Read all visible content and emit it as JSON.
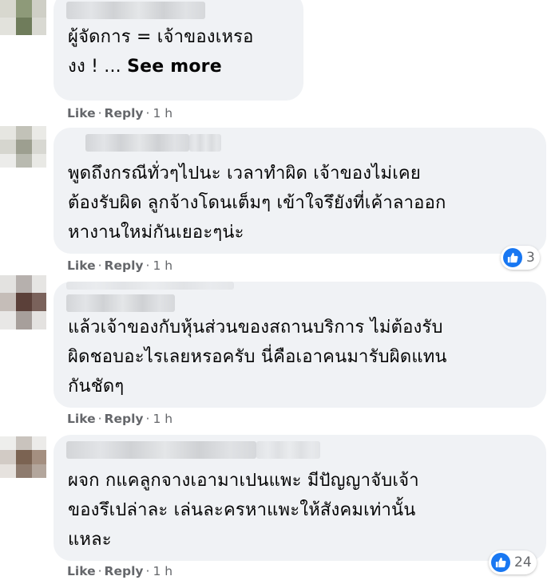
{
  "comments": [
    {
      "lines": [
        "ผู้จัดการ = เจ้าของเหรอ",
        "งง ! ... "
      ],
      "see_more": "See more",
      "actions": {
        "like": "Like",
        "reply": "Reply",
        "sep": "·",
        "time": "1 h"
      },
      "reactions": null
    },
    {
      "lines": [
        "พูดถึงกรณีทั่วๆไปนะ เวลาทำผิด เจ้าของไม่เคย",
        "ต้องรับผิด ลูกจ้างโดนเต็มๆ เข้าใจรึยังที่เค้าลาออก",
        "หางานใหม่กันเยอะๆน่ะ"
      ],
      "actions": {
        "like": "Like",
        "reply": "Reply",
        "sep": "·",
        "time": "1 h"
      },
      "reactions": {
        "icon": "like-icon",
        "count": "3"
      }
    },
    {
      "lines": [
        "แล้วเจ้าของกับหุ้นส่วนของสถานบริการ ไม่ต้องรับ",
        "ผิดชอบอะไรเลยหรอครับ นี่คือเอาคนมารับผิดแทน",
        "กันชัดๆ"
      ],
      "actions": {
        "like": "Like",
        "reply": "Reply",
        "sep": "·",
        "time": "1 h"
      },
      "reactions": null
    },
    {
      "lines": [
        "ผจก กแคลูกจางเอามาเปนแพะ มีปัญญาจับเจ้า",
        "ของรึเปล่าละ เล่นละครหาแพะให้สังคมเท่านั้น",
        "แหละ"
      ],
      "actions": {
        "like": "Like",
        "reply": "Reply",
        "sep": "·",
        "time": "1 h"
      },
      "reactions": {
        "icon": "like-icon",
        "count": "24"
      }
    }
  ],
  "colors": {
    "bubble": "#f0f2f5",
    "meta": "#65676b",
    "like_blue": "#1877f2",
    "text": "#050505"
  }
}
